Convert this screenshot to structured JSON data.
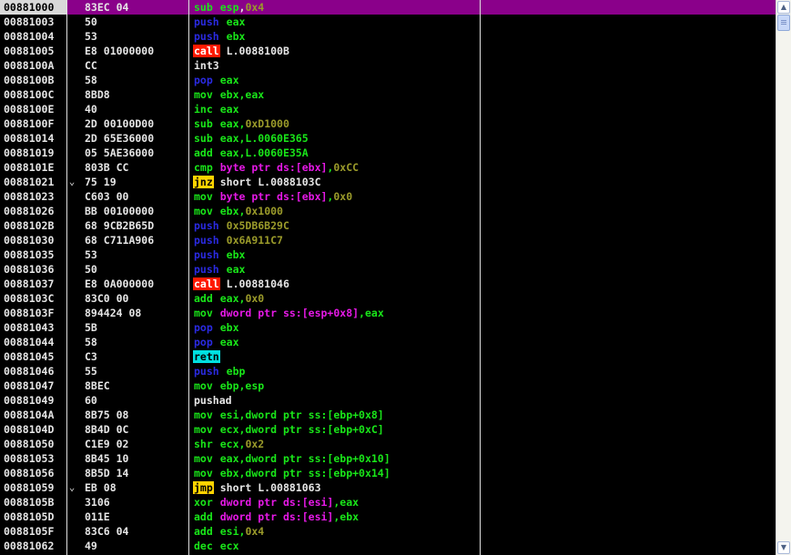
{
  "rows": [
    {
      "addr": "00881000",
      "marker": "",
      "bytes": "83EC 04",
      "mnemonic": "sub",
      "mn_style": "op",
      "operands": [
        {
          "t": "esp",
          "s": "op"
        },
        {
          "t": ",",
          "s": "op-white"
        },
        {
          "t": "0x4",
          "s": "op-imm"
        }
      ],
      "selected": true
    },
    {
      "addr": "00881003",
      "marker": "",
      "bytes": "50",
      "mnemonic": "push",
      "mn_style": "push",
      "operands": [
        {
          "t": "eax",
          "s": "op"
        }
      ]
    },
    {
      "addr": "00881004",
      "marker": "",
      "bytes": "53",
      "mnemonic": "push",
      "mn_style": "push",
      "operands": [
        {
          "t": "ebx",
          "s": "op"
        }
      ]
    },
    {
      "addr": "00881005",
      "marker": "",
      "bytes": "E8 01000000",
      "mnemonic": "call",
      "mn_style": "call",
      "operands": [
        {
          "t": "L.0088100B",
          "s": "op-label"
        }
      ]
    },
    {
      "addr": "0088100A",
      "marker": "",
      "bytes": "CC",
      "mnemonic": "int3",
      "mn_style": "plain",
      "operands": []
    },
    {
      "addr": "0088100B",
      "marker": "",
      "bytes": "58",
      "mnemonic": "pop",
      "mn_style": "pop",
      "operands": [
        {
          "t": "eax",
          "s": "op"
        }
      ]
    },
    {
      "addr": "0088100C",
      "marker": "",
      "bytes": "8BD8",
      "mnemonic": "mov",
      "mn_style": "op",
      "operands": [
        {
          "t": "ebx,eax",
          "s": "op"
        }
      ]
    },
    {
      "addr": "0088100E",
      "marker": "",
      "bytes": "40",
      "mnemonic": "inc",
      "mn_style": "op",
      "operands": [
        {
          "t": "eax",
          "s": "op"
        }
      ]
    },
    {
      "addr": "0088100F",
      "marker": "",
      "bytes": "2D 00100D00",
      "mnemonic": "sub",
      "mn_style": "op",
      "operands": [
        {
          "t": "eax",
          "s": "op"
        },
        {
          "t": ",",
          "s": "op"
        },
        {
          "t": "0xD1000",
          "s": "op-imm"
        }
      ]
    },
    {
      "addr": "00881014",
      "marker": "",
      "bytes": "2D 65E36000",
      "mnemonic": "sub",
      "mn_style": "op",
      "operands": [
        {
          "t": "eax,L.0060E365",
          "s": "op"
        }
      ]
    },
    {
      "addr": "00881019",
      "marker": "",
      "bytes": "05 5AE36000",
      "mnemonic": "add",
      "mn_style": "op",
      "operands": [
        {
          "t": "eax,L.0060E35A",
          "s": "op"
        }
      ]
    },
    {
      "addr": "0088101E",
      "marker": "",
      "bytes": "803B CC",
      "mnemonic": "cmp",
      "mn_style": "op",
      "operands": [
        {
          "t": "byte ptr ds:[ebx]",
          "s": "op-mem"
        },
        {
          "t": ",",
          "s": "op"
        },
        {
          "t": "0xCC",
          "s": "op-imm"
        }
      ]
    },
    {
      "addr": "00881021",
      "marker": "⌄",
      "bytes": "75 19",
      "mnemonic": "jnz",
      "mn_style": "jmp",
      "operands": [
        {
          "t": "short L.0088103C",
          "s": "op-label"
        }
      ]
    },
    {
      "addr": "00881023",
      "marker": "",
      "bytes": "C603 00",
      "mnemonic": "mov",
      "mn_style": "op",
      "operands": [
        {
          "t": "byte ptr ds:[ebx]",
          "s": "op-mem"
        },
        {
          "t": ",",
          "s": "op"
        },
        {
          "t": "0x0",
          "s": "op-imm"
        }
      ]
    },
    {
      "addr": "00881026",
      "marker": "",
      "bytes": "BB 00100000",
      "mnemonic": "mov",
      "mn_style": "op",
      "operands": [
        {
          "t": "ebx",
          "s": "op"
        },
        {
          "t": ",",
          "s": "op"
        },
        {
          "t": "0x1000",
          "s": "op-imm"
        }
      ]
    },
    {
      "addr": "0088102B",
      "marker": "",
      "bytes": "68 9CB2B65D",
      "mnemonic": "push",
      "mn_style": "push",
      "operands": [
        {
          "t": "0x5DB6B29C",
          "s": "op-imm"
        }
      ]
    },
    {
      "addr": "00881030",
      "marker": "",
      "bytes": "68 C711A906",
      "mnemonic": "push",
      "mn_style": "push",
      "operands": [
        {
          "t": "0x6A911C7",
          "s": "op-imm"
        }
      ]
    },
    {
      "addr": "00881035",
      "marker": "",
      "bytes": "53",
      "mnemonic": "push",
      "mn_style": "push",
      "operands": [
        {
          "t": "ebx",
          "s": "op"
        }
      ]
    },
    {
      "addr": "00881036",
      "marker": "",
      "bytes": "50",
      "mnemonic": "push",
      "mn_style": "push",
      "operands": [
        {
          "t": "eax",
          "s": "op"
        }
      ]
    },
    {
      "addr": "00881037",
      "marker": "",
      "bytes": "E8 0A000000",
      "mnemonic": "call",
      "mn_style": "call",
      "operands": [
        {
          "t": "L.00881046",
          "s": "op-label"
        }
      ]
    },
    {
      "addr": "0088103C",
      "marker": "",
      "bytes": "83C0 00",
      "mnemonic": "add",
      "mn_style": "op",
      "operands": [
        {
          "t": "eax",
          "s": "op"
        },
        {
          "t": ",",
          "s": "op"
        },
        {
          "t": "0x0",
          "s": "op-imm"
        }
      ]
    },
    {
      "addr": "0088103F",
      "marker": "",
      "bytes": "894424 08",
      "mnemonic": "mov",
      "mn_style": "op",
      "operands": [
        {
          "t": "dword ptr ss:[esp+0x8]",
          "s": "op-mem"
        },
        {
          "t": ",eax",
          "s": "op"
        }
      ]
    },
    {
      "addr": "00881043",
      "marker": "",
      "bytes": "5B",
      "mnemonic": "pop",
      "mn_style": "pop",
      "operands": [
        {
          "t": "ebx",
          "s": "op"
        }
      ]
    },
    {
      "addr": "00881044",
      "marker": "",
      "bytes": "58",
      "mnemonic": "pop",
      "mn_style": "pop",
      "operands": [
        {
          "t": "eax",
          "s": "op"
        }
      ]
    },
    {
      "addr": "00881045",
      "marker": "",
      "bytes": "C3",
      "mnemonic": "retn",
      "mn_style": "retn",
      "operands": []
    },
    {
      "addr": "00881046",
      "marker": "",
      "bytes": "55",
      "mnemonic": "push",
      "mn_style": "push",
      "operands": [
        {
          "t": "ebp",
          "s": "op"
        }
      ]
    },
    {
      "addr": "00881047",
      "marker": "",
      "bytes": "8BEC",
      "mnemonic": "mov",
      "mn_style": "op",
      "operands": [
        {
          "t": "ebp,esp",
          "s": "op"
        }
      ]
    },
    {
      "addr": "00881049",
      "marker": "",
      "bytes": "60",
      "mnemonic": "pushad",
      "mn_style": "plain",
      "operands": []
    },
    {
      "addr": "0088104A",
      "marker": "",
      "bytes": "8B75 08",
      "mnemonic": "mov",
      "mn_style": "op",
      "operands": [
        {
          "t": "esi,dword ptr ss:[ebp+0x8]",
          "s": "op"
        }
      ]
    },
    {
      "addr": "0088104D",
      "marker": "",
      "bytes": "8B4D 0C",
      "mnemonic": "mov",
      "mn_style": "op",
      "operands": [
        {
          "t": "ecx,dword ptr ss:[ebp+0xC]",
          "s": "op"
        }
      ]
    },
    {
      "addr": "00881050",
      "marker": "",
      "bytes": "C1E9 02",
      "mnemonic": "shr",
      "mn_style": "op",
      "operands": [
        {
          "t": "ecx",
          "s": "op"
        },
        {
          "t": ",",
          "s": "op"
        },
        {
          "t": "0x2",
          "s": "op-imm"
        }
      ]
    },
    {
      "addr": "00881053",
      "marker": "",
      "bytes": "8B45 10",
      "mnemonic": "mov",
      "mn_style": "op",
      "operands": [
        {
          "t": "eax,dword ptr ss:[ebp+0x10]",
          "s": "op"
        }
      ]
    },
    {
      "addr": "00881056",
      "marker": "",
      "bytes": "8B5D 14",
      "mnemonic": "mov",
      "mn_style": "op",
      "operands": [
        {
          "t": "ebx,dword ptr ss:[ebp+0x14]",
          "s": "op"
        }
      ]
    },
    {
      "addr": "00881059",
      "marker": "⌄",
      "bytes": "EB 08",
      "mnemonic": "jmp",
      "mn_style": "jmp",
      "operands": [
        {
          "t": "short L.00881063",
          "s": "op-label"
        }
      ]
    },
    {
      "addr": "0088105B",
      "marker": "",
      "bytes": "3106",
      "mnemonic": "xor",
      "mn_style": "op",
      "operands": [
        {
          "t": "dword ptr ds:[esi]",
          "s": "op-mem"
        },
        {
          "t": ",eax",
          "s": "op"
        }
      ]
    },
    {
      "addr": "0088105D",
      "marker": "",
      "bytes": "011E",
      "mnemonic": "add",
      "mn_style": "op",
      "operands": [
        {
          "t": "dword ptr ds:[esi]",
          "s": "op-mem"
        },
        {
          "t": ",ebx",
          "s": "op"
        }
      ]
    },
    {
      "addr": "0088105F",
      "marker": "",
      "bytes": "83C6 04",
      "mnemonic": "add",
      "mn_style": "op",
      "operands": [
        {
          "t": "esi",
          "s": "op"
        },
        {
          "t": ",",
          "s": "op"
        },
        {
          "t": "0x4",
          "s": "op-imm"
        }
      ]
    },
    {
      "addr": "00881062",
      "marker": "",
      "bytes": "49",
      "mnemonic": "dec",
      "mn_style": "op",
      "operands": [
        {
          "t": "ecx",
          "s": "op"
        }
      ]
    }
  ],
  "scrollbar": {
    "up_icon": "up-arrow-icon",
    "down_icon": "down-arrow-icon",
    "up_glyph": "▲",
    "down_glyph": "▼"
  }
}
